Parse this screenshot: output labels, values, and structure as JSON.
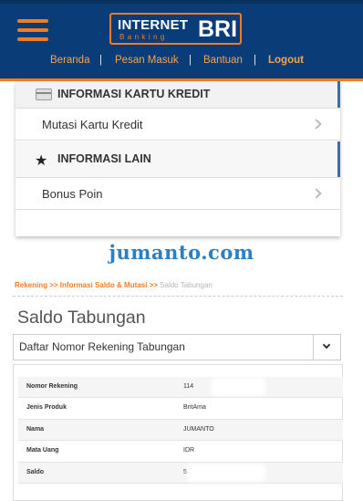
{
  "header": {
    "logo": {
      "line1": "INTERNET",
      "line2": "Banking",
      "brand": "BRI"
    },
    "colors": {
      "navy": "#0a3d78",
      "orange": "#f47c20"
    },
    "menu_icon": "hamburger-icon",
    "nav": [
      {
        "label": "Beranda"
      },
      {
        "label": "Pesan Masuk"
      },
      {
        "label": "Bantuan"
      },
      {
        "label": "Logout"
      }
    ],
    "separator": "|"
  },
  "menu": {
    "sections": [
      {
        "title": "INFORMASI KARTU KREDIT",
        "icon": "credit-card-icon",
        "items": [
          {
            "label": "Mutasi Kartu Kredit"
          }
        ]
      },
      {
        "title": "INFORMASI LAIN",
        "icon": "star-icon",
        "items": [
          {
            "label": "Bonus Poin"
          }
        ]
      }
    ]
  },
  "watermark": "jumanto.com",
  "breadcrumb": {
    "part1": "Rekening >> ",
    "part2": "Informasi Saldo & Mutasi >> ",
    "current": "Saldo Tabungan"
  },
  "page": {
    "title": "Saldo Tabungan"
  },
  "account_select": {
    "value": "Daftar Nomor Rekening Tabungan"
  },
  "account_info": {
    "rows": [
      {
        "label": "Nomor Rekening",
        "value": "114"
      },
      {
        "label": "Jenis Produk",
        "value": "BritAma"
      },
      {
        "label": "Nama",
        "value": "JUMANTO"
      },
      {
        "label": "Mata Uang",
        "value": "IDR"
      },
      {
        "label": "Saldo",
        "value": "5"
      }
    ]
  }
}
